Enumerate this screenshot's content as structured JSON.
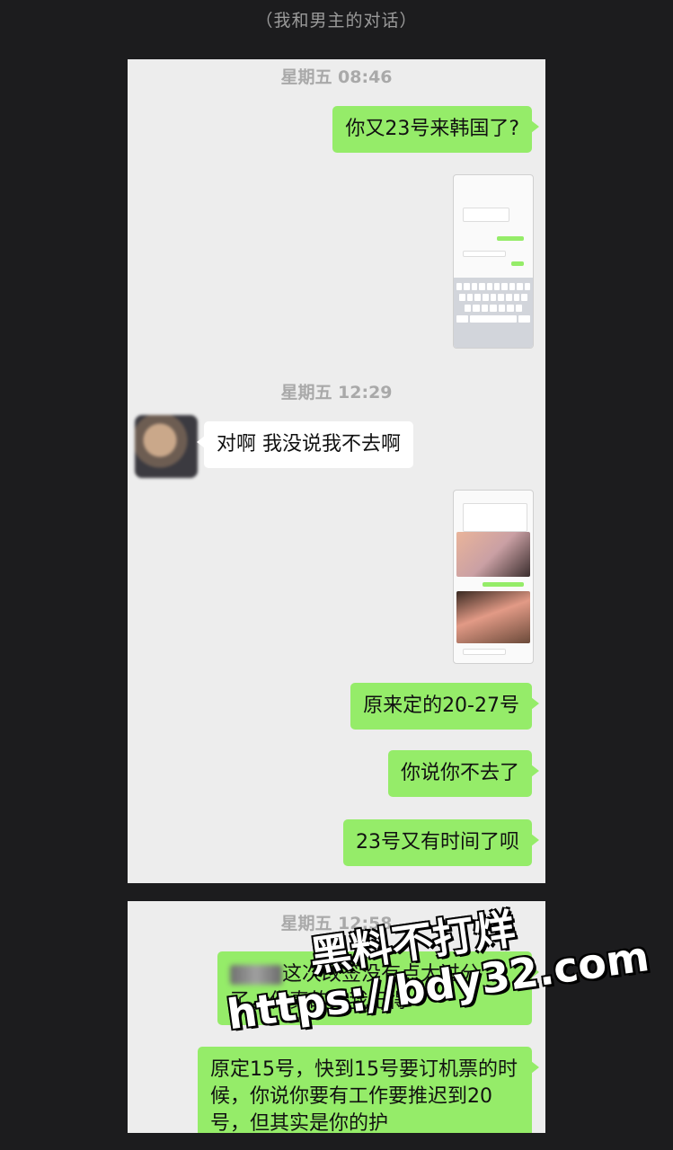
{
  "caption": "（我和男主的对话）",
  "panel1": {
    "timestamp_1": "星期五 08:46",
    "msg_1": "你又23号来韩国了?",
    "timestamp_2": "星期五 12:29",
    "msg_2": "对啊 我没说我不去啊",
    "msg_3": "原来定的20-27号",
    "msg_4": "你说你不去了",
    "msg_5": "23号又有时间了呗"
  },
  "panel2": {
    "timestamp": "星期五 12:58",
    "msg_1_line1": "这次改签没有点太过分",
    "msg_1_line2": "了，你真的拖我记得",
    "msg_2": "原定15号，快到15号要订机票的时候，你说你要有工作要推迟到20号，但其实是你的护"
  },
  "watermark": {
    "line1": "黑料不打烊",
    "line2": "https://bdy32.com"
  },
  "icons": {
    "avatar": "blurred-profile-photo",
    "screenshot_1": "wechat-chat-screenshot-with-keyboard",
    "screenshot_2": "wechat-chat-screenshot-with-photos"
  },
  "colors": {
    "sent_bubble": "#95ec69",
    "received_bubble": "#ffffff",
    "panel_bg": "#ededed",
    "page_bg": "#1c1c1e"
  }
}
